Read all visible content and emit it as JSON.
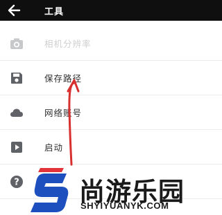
{
  "app_bar": {
    "title": "工具",
    "background": "#0f0f0f"
  },
  "menu": {
    "items": [
      {
        "label": "相机分辨率",
        "icon": "camera-icon",
        "enabled": false
      },
      {
        "label": "保存路径",
        "icon": "save-icon",
        "enabled": true
      },
      {
        "label": "网络账号",
        "icon": "cloud-icon",
        "enabled": true
      },
      {
        "label": "启动",
        "icon": "play-icon",
        "enabled": true
      },
      {
        "label": "",
        "icon": "help-icon",
        "enabled": true
      }
    ]
  },
  "watermark": {
    "chinese": "尚游乐园",
    "english": "SHYIYUANYK.COM",
    "colors": {
      "blue": "#1d4fbf",
      "red": "#e2333a"
    }
  },
  "annotation": {
    "arrow_color": "#d8302f"
  }
}
